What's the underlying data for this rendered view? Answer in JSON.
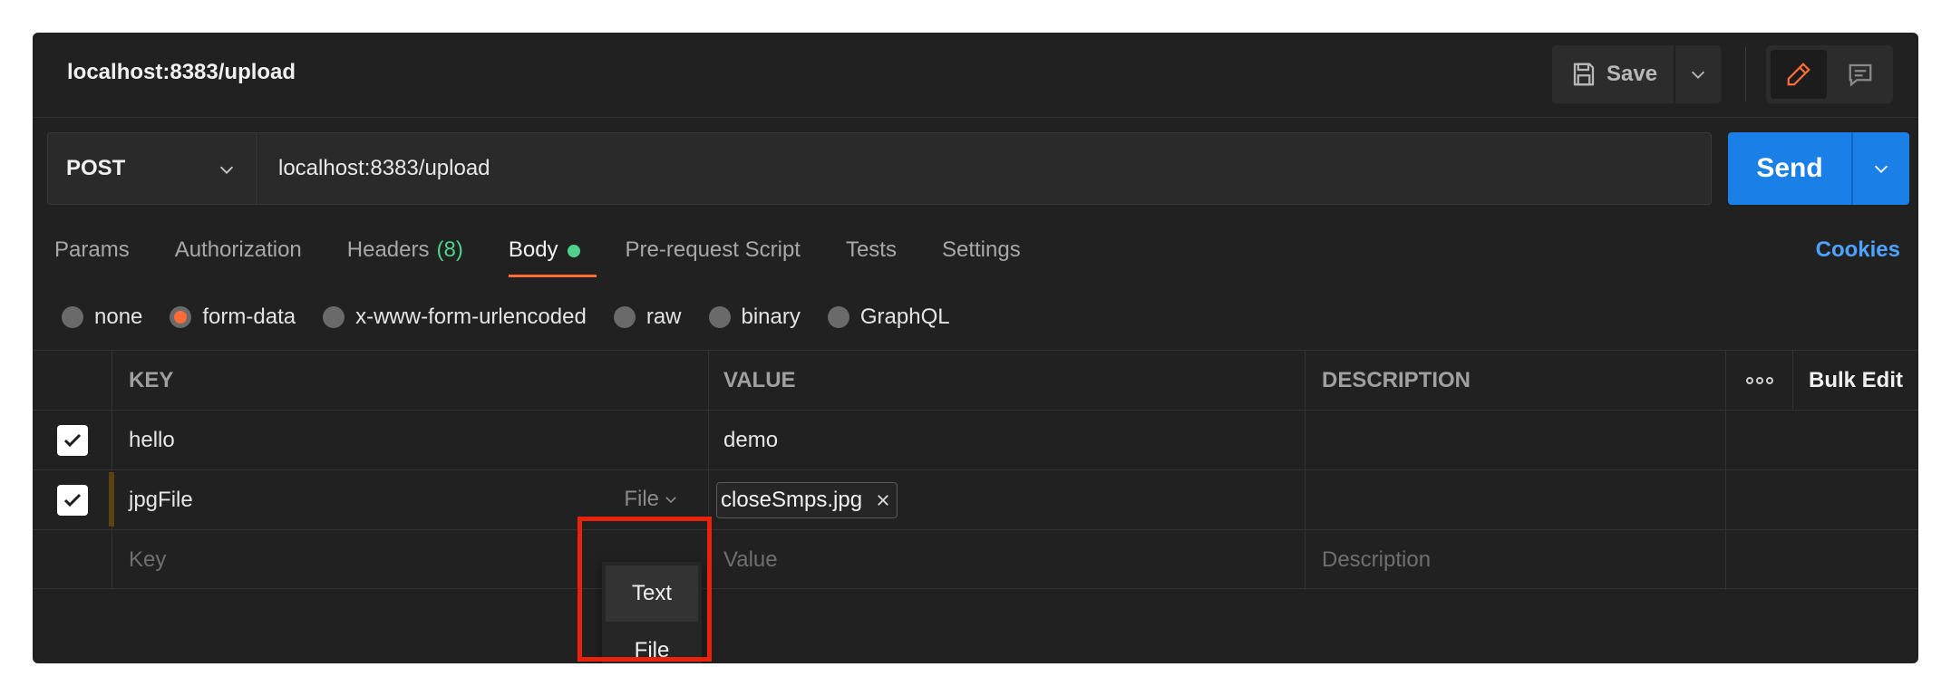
{
  "titlebar": {
    "title": "localhost:8383/upload",
    "save_label": "Save"
  },
  "request": {
    "method": "POST",
    "url": "localhost:8383/upload",
    "send_label": "Send"
  },
  "tabs": [
    {
      "label": "Params"
    },
    {
      "label": "Authorization"
    },
    {
      "label": "Headers",
      "count": "(8)"
    },
    {
      "label": "Body",
      "active": true
    },
    {
      "label": "Pre-request Script"
    },
    {
      "label": "Tests"
    },
    {
      "label": "Settings"
    }
  ],
  "cookies_label": "Cookies",
  "body_types": [
    {
      "label": "none",
      "checked": false
    },
    {
      "label": "form-data",
      "checked": true
    },
    {
      "label": "x-www-form-urlencoded",
      "checked": false
    },
    {
      "label": "raw",
      "checked": false
    },
    {
      "label": "binary",
      "checked": false
    },
    {
      "label": "GraphQL",
      "checked": false
    }
  ],
  "table": {
    "headers": {
      "key": "KEY",
      "value": "VALUE",
      "description": "DESCRIPTION",
      "bulk_edit": "Bulk Edit"
    },
    "rows": [
      {
        "key": "hello",
        "value": "demo",
        "checked": true
      },
      {
        "key": "jpgFile",
        "type": "File",
        "file": "closeSmps.jpg",
        "checked": true
      }
    ],
    "new_row": {
      "key_placeholder": "Key",
      "value_placeholder": "Value",
      "description_placeholder": "Description"
    }
  },
  "type_dropdown": {
    "options": [
      "Text",
      "File"
    ]
  },
  "colors": {
    "accent": "#ff6c37",
    "send": "#1a7fe6",
    "link": "#4da3ff",
    "success": "#4fd18b",
    "highlight": "#e8230a"
  }
}
